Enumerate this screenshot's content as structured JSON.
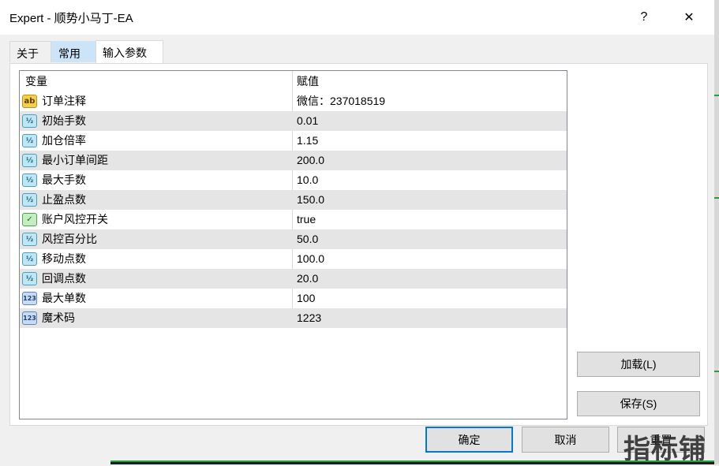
{
  "window": {
    "title": "Expert - 顺势小马丁-EA",
    "help_glyph": "?",
    "close_glyph": "✕"
  },
  "tabs": [
    {
      "label": "关于"
    },
    {
      "label": "常用"
    },
    {
      "label": "输入参数"
    }
  ],
  "grid": {
    "header": {
      "name": "变量",
      "value": "赋值"
    },
    "rows": [
      {
        "icon": "ab",
        "name": "订单注释",
        "value": "微信：237018519"
      },
      {
        "icon": "½",
        "name": "初始手数",
        "value": "0.01"
      },
      {
        "icon": "½",
        "name": "加仓倍率",
        "value": "1.15"
      },
      {
        "icon": "½",
        "name": "最小订单间距",
        "value": "200.0"
      },
      {
        "icon": "½",
        "name": "最大手数",
        "value": "10.0"
      },
      {
        "icon": "½",
        "name": "止盈点数",
        "value": "150.0"
      },
      {
        "icon": "✓",
        "name": "账户风控开关",
        "value": "true"
      },
      {
        "icon": "½",
        "name": "风控百分比",
        "value": "50.0"
      },
      {
        "icon": "½",
        "name": "移动点数",
        "value": "100.0"
      },
      {
        "icon": "½",
        "name": "回调点数",
        "value": "20.0"
      },
      {
        "icon": "123",
        "name": "最大单数",
        "value": "100"
      },
      {
        "icon": "123",
        "name": "魔术码",
        "value": "1223"
      }
    ]
  },
  "buttons": {
    "load": "加载(L)",
    "save": "保存(S)",
    "ok": "确定",
    "cancel": "取消",
    "reset": "重置"
  },
  "watermark": "指标铺",
  "colors": {
    "alt_row": "#e5e5e5",
    "ok_border": "#0078d7",
    "active_tab_hover": "#cce4f7"
  }
}
